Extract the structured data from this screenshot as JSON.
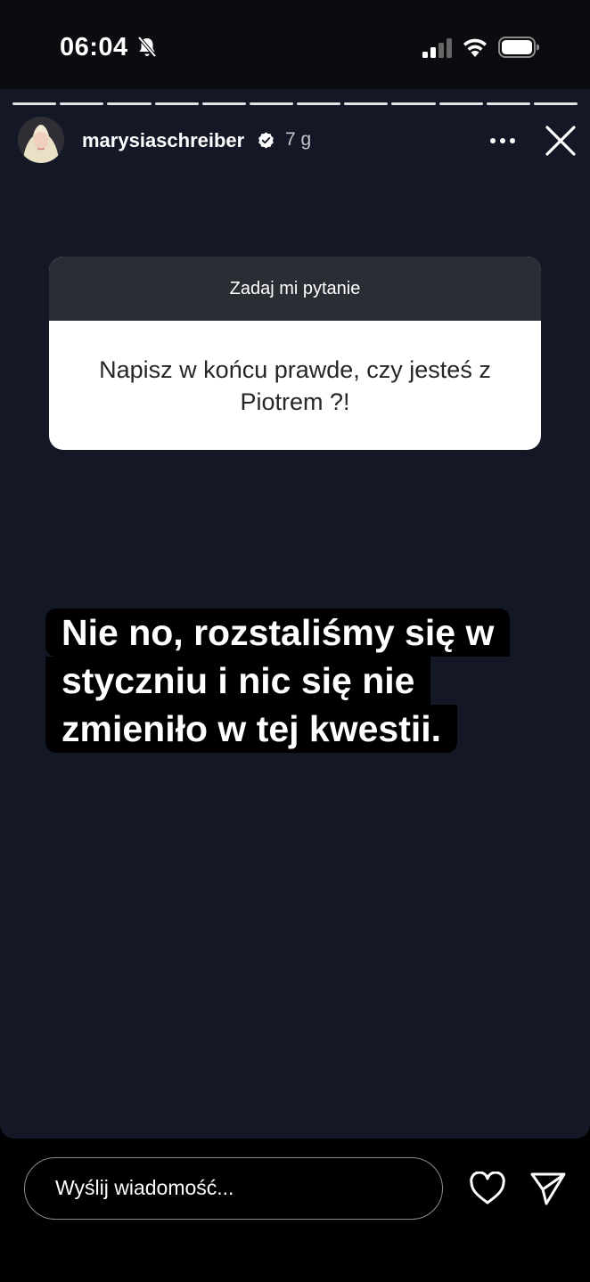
{
  "status": {
    "time": "06:04"
  },
  "story": {
    "segments": 12,
    "username": "marysiaschreiber",
    "age": "7 g",
    "question_sticker": {
      "header": "Zadaj mi pytanie",
      "question": "Napisz w końcu prawde, czy jesteś z Piotrem ?!"
    },
    "answer_lines": [
      "Nie no, rozstaliśmy się w",
      "styczniu i nic się nie",
      "zmieniło w tej kwestii."
    ]
  },
  "reply": {
    "placeholder": "Wyślij wiadomość..."
  }
}
